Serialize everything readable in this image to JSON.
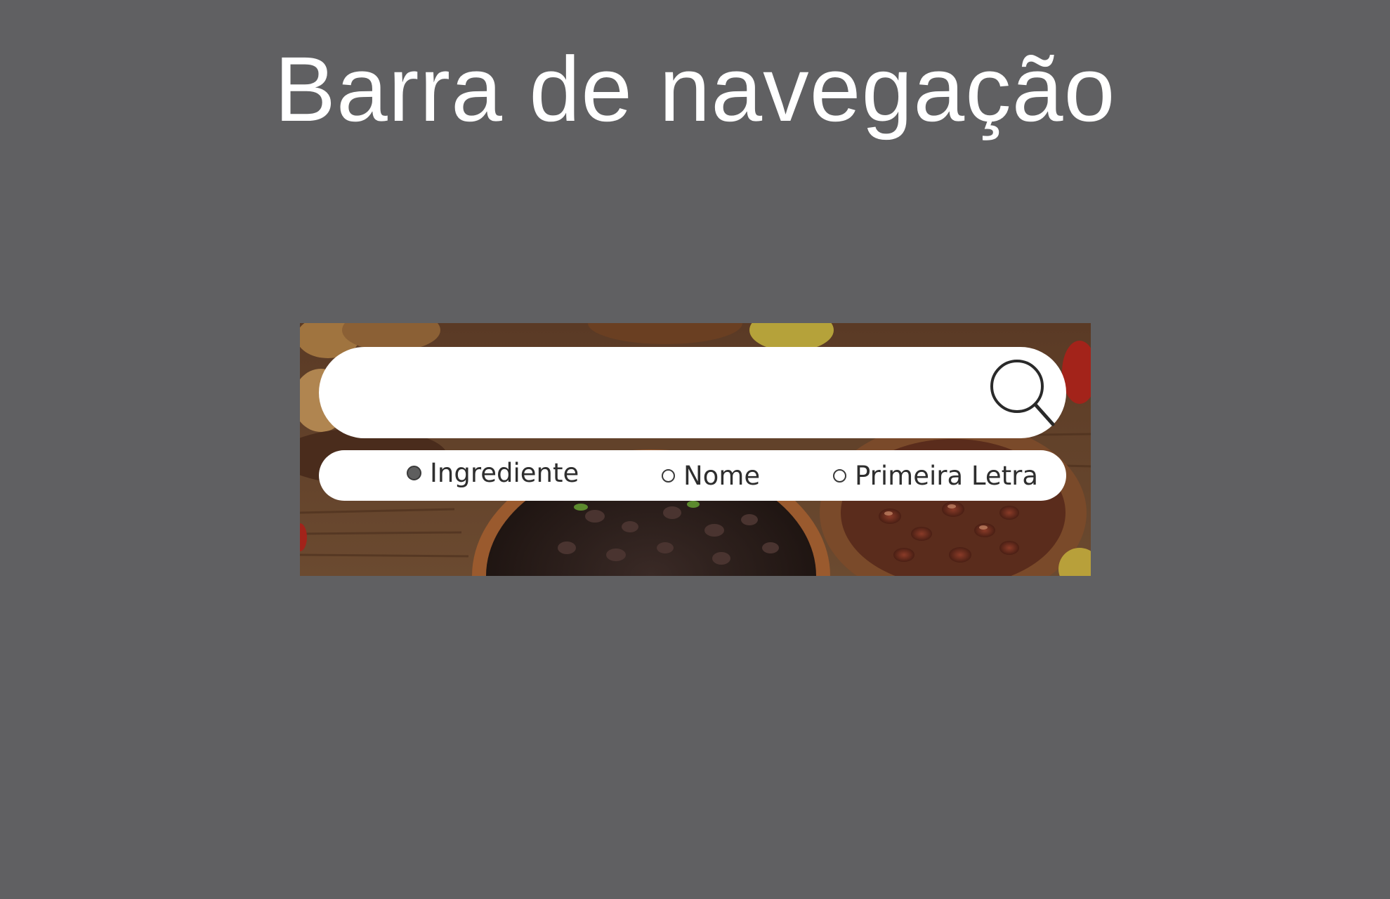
{
  "page": {
    "title": "Barra de navegação",
    "background": "#606062"
  },
  "search": {
    "placeholder": "",
    "value": "",
    "button_icon": "search-icon"
  },
  "search_options": [
    {
      "label": "Ingrediente",
      "selected": true
    },
    {
      "label": "Nome",
      "selected": false
    },
    {
      "label": "Primeira Letra",
      "selected": false
    }
  ],
  "banner": {
    "image": "food-background-beans-bowls"
  }
}
